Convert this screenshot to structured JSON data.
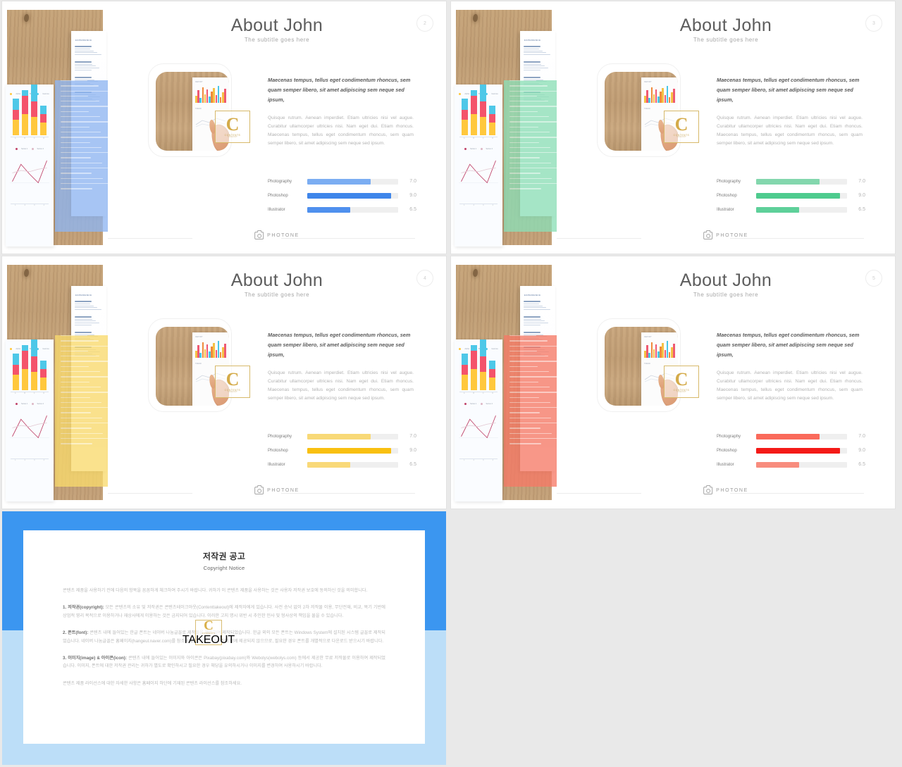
{
  "slides": [
    {
      "page": "2",
      "accent": "#7aa9f0",
      "accent_panel": "#8fb6f2",
      "bar_light": "#7badf2",
      "bar_strong": "#3f86ea",
      "bar_third": "#4f90ee"
    },
    {
      "page": "3",
      "accent": "#80d6ae",
      "accent_panel": "#8ddfb7",
      "bar_light": "#83d7ad",
      "bar_strong": "#4ecb8e",
      "bar_third": "#5ed09a"
    },
    {
      "page": "4",
      "accent": "#f8d765",
      "accent_panel": "#f9da6d",
      "bar_light": "#f8d977",
      "bar_strong": "#f9c010",
      "bar_third": "#f9d978"
    },
    {
      "page": "5",
      "accent": "#f4705c",
      "accent_panel": "#f67a66",
      "bar_light": "#fa6a5b",
      "bar_strong": "#f41a17",
      "bar_third": "#f88c7d"
    }
  ],
  "slide": {
    "title": "About John",
    "subtitle": "The subtitle goes here",
    "lead": "Maecenas tempus, tellus eget condimentum rhoncus, sem quam semper libero, sit amet adipiscing sem neque sed ipsum,",
    "body": "Quisque rutrum. Aenean imperdiet. Etiam ultricies nisi vel augue. Curabitur ullamcorper ultricies nisi. Nam eget dui. Etiam rhoncus. Maecenas tempus, tellus eget condimentum rhoncus, sem quam semper libero, sit amet adipiscing sem neque sed ipsum.",
    "skills": [
      {
        "label": "Photography",
        "value": "7.0",
        "percent": 70
      },
      {
        "label": "Photoshop",
        "value": "9.0",
        "percent": 92
      },
      {
        "label": "Illustrator",
        "value": "6.5",
        "percent": 47
      }
    ],
    "footer": {
      "brand": "PHOTONE",
      "icon": "camera-icon"
    },
    "resume": {
      "heading": "EXPERIENCE"
    },
    "mini_chart": {
      "legend": [
        "Alpha",
        "Beta",
        "Gamma"
      ],
      "legend_colors": [
        "#ffc83d",
        "#f4536b",
        "#4ec8e8"
      ],
      "bars": [
        {
          "x": "A",
          "segments": [
            22,
            14,
            16
          ]
        },
        {
          "x": "B",
          "segments": [
            30,
            26,
            8
          ]
        },
        {
          "x": "C",
          "segments": [
            26,
            22,
            26
          ]
        },
        {
          "x": "D",
          "segments": [
            18,
            12,
            12
          ]
        }
      ],
      "line_legend": [
        "Series 1",
        "Series 2"
      ],
      "line_points": "4,42 18,14 32,30 46,44 60,8"
    },
    "photo_chart": {
      "label_top": "REPORT",
      "label_mid": "TREND",
      "bars": [
        10,
        18,
        7,
        22,
        12,
        19,
        9,
        16,
        21,
        11,
        24,
        8,
        15,
        20
      ]
    }
  },
  "copyright": {
    "title": "저작권 공고",
    "subtitle": "Copyright Notice",
    "paragraphs": [
      {
        "lead": "",
        "text": "콘텐츠 제품을 사용하기 전에 다음의 항목을 꼼꼼하게 체크하여 주시기 바랍니다. 귀하가 이 콘텐츠 제품을 사용하는 것은 사용자 저작권 보호에 동의하신 것을 의미합니다."
      },
      {
        "lead": "1. 저작권(copyright):",
        "text": " 모든 콘텐츠의 소유 및 저작권은 콘텐츠테이크아웃(Contenttakeout)에 제작자에게 있습니다. 사전 승낙 없이 2차 저작물 이용, 무단전재, 비교, 복기 기반에 상업적 영리 목적으로 이용하거나 재상사에게 이용하는 것은 금지되어 있습니다. 이러한 고지 명시 위반 시 추인한 민사 및 형사상의 책임을 물을 수 있습니다."
      },
      {
        "lead": "2. 폰트(font):",
        "text": " 콘텐츠 내에 들어있는 한글 폰트는 네이버 나눔글꼴로 제작물을 제작하여 제작되었습니다. 한글 외의 모든 폰트는 Windows System에 설치된 시스템 글꼴로 제작되었습니다. 네이버 나눔글꼴은 홈페이지(hangeul.naver.com)를 참조하세요. 폰트는 콘텐츠의 함께 제공되지 않으므로, 필요한 경우 폰트를 개별적으로 다운로드 받으시기 바랍니다."
      },
      {
        "lead": "3. 이미지(image) & 아이콘(icon):",
        "text": " 콘텐츠 내에 들어있는 이미지와 아이콘은 Pixabay(pixabay.com)와 Webolys(webolys.com) 등에서 제공한 무료 저작물로 이용하여 제작되었습니다. 이미지, 폰트에 대한 저작권 관리는 귀하가 별도로 확인하시고 필요한 경우 해당을 유의하시거나 이미지를 변경하여 사용하시기 바랍니다."
      },
      {
        "lead": "",
        "text": "콘텐츠 제품 라이선스에 대한 자세한 사항은 홈페이지 하단에 기재된 콘텐츠 라이선스를 참조하세요."
      }
    ],
    "watermark": {
      "letter": "C",
      "name": "CONTENTS",
      "sub": "TAKEOUT"
    }
  },
  "watermark": {
    "letter": "C",
    "name": "CONTENTS",
    "sub": "TAKEOUT"
  }
}
